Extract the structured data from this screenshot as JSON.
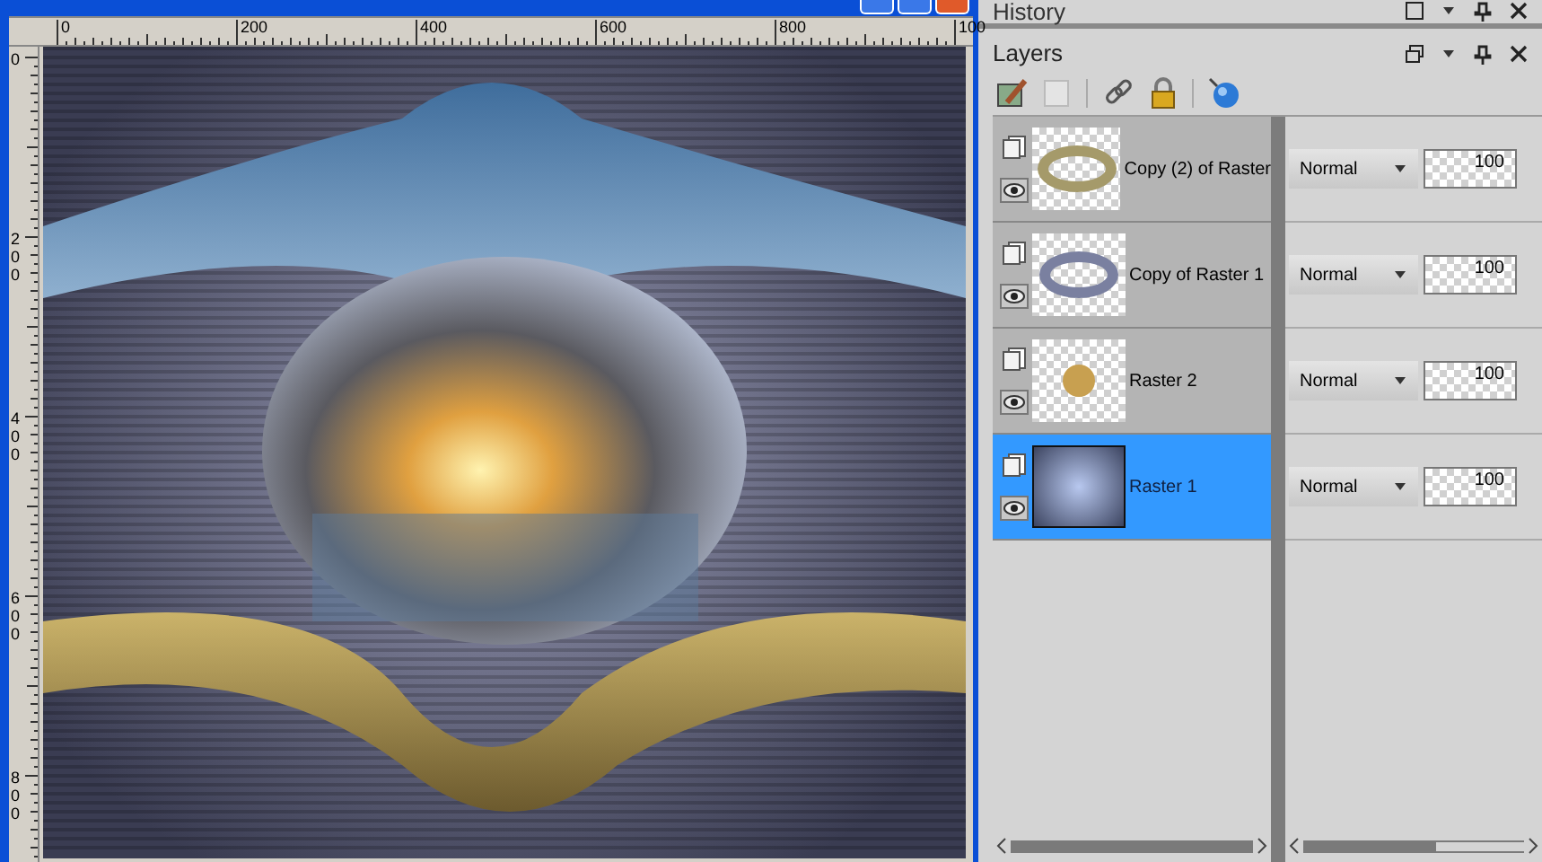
{
  "rulers": {
    "horizontal": [
      "0",
      "200",
      "400",
      "600",
      "800",
      "100"
    ],
    "vertical": [
      "0",
      "200",
      "400",
      "600",
      "800"
    ]
  },
  "history_panel": {
    "title": "History"
  },
  "layers_panel": {
    "title": "Layers",
    "layers": [
      {
        "name": "Copy (2) of Raster",
        "kind": "gold-ring",
        "visible": true,
        "selected": false,
        "blend_mode": "Normal",
        "opacity": "100"
      },
      {
        "name": "Copy of Raster 1",
        "kind": "grey-ring",
        "visible": true,
        "selected": false,
        "blend_mode": "Normal",
        "opacity": "100"
      },
      {
        "name": "Raster 2",
        "kind": "small-art",
        "visible": true,
        "selected": false,
        "blend_mode": "Normal",
        "opacity": "100"
      },
      {
        "name": "Raster 1",
        "kind": "gradient",
        "visible": true,
        "selected": true,
        "blend_mode": "Normal",
        "opacity": "100"
      }
    ]
  }
}
